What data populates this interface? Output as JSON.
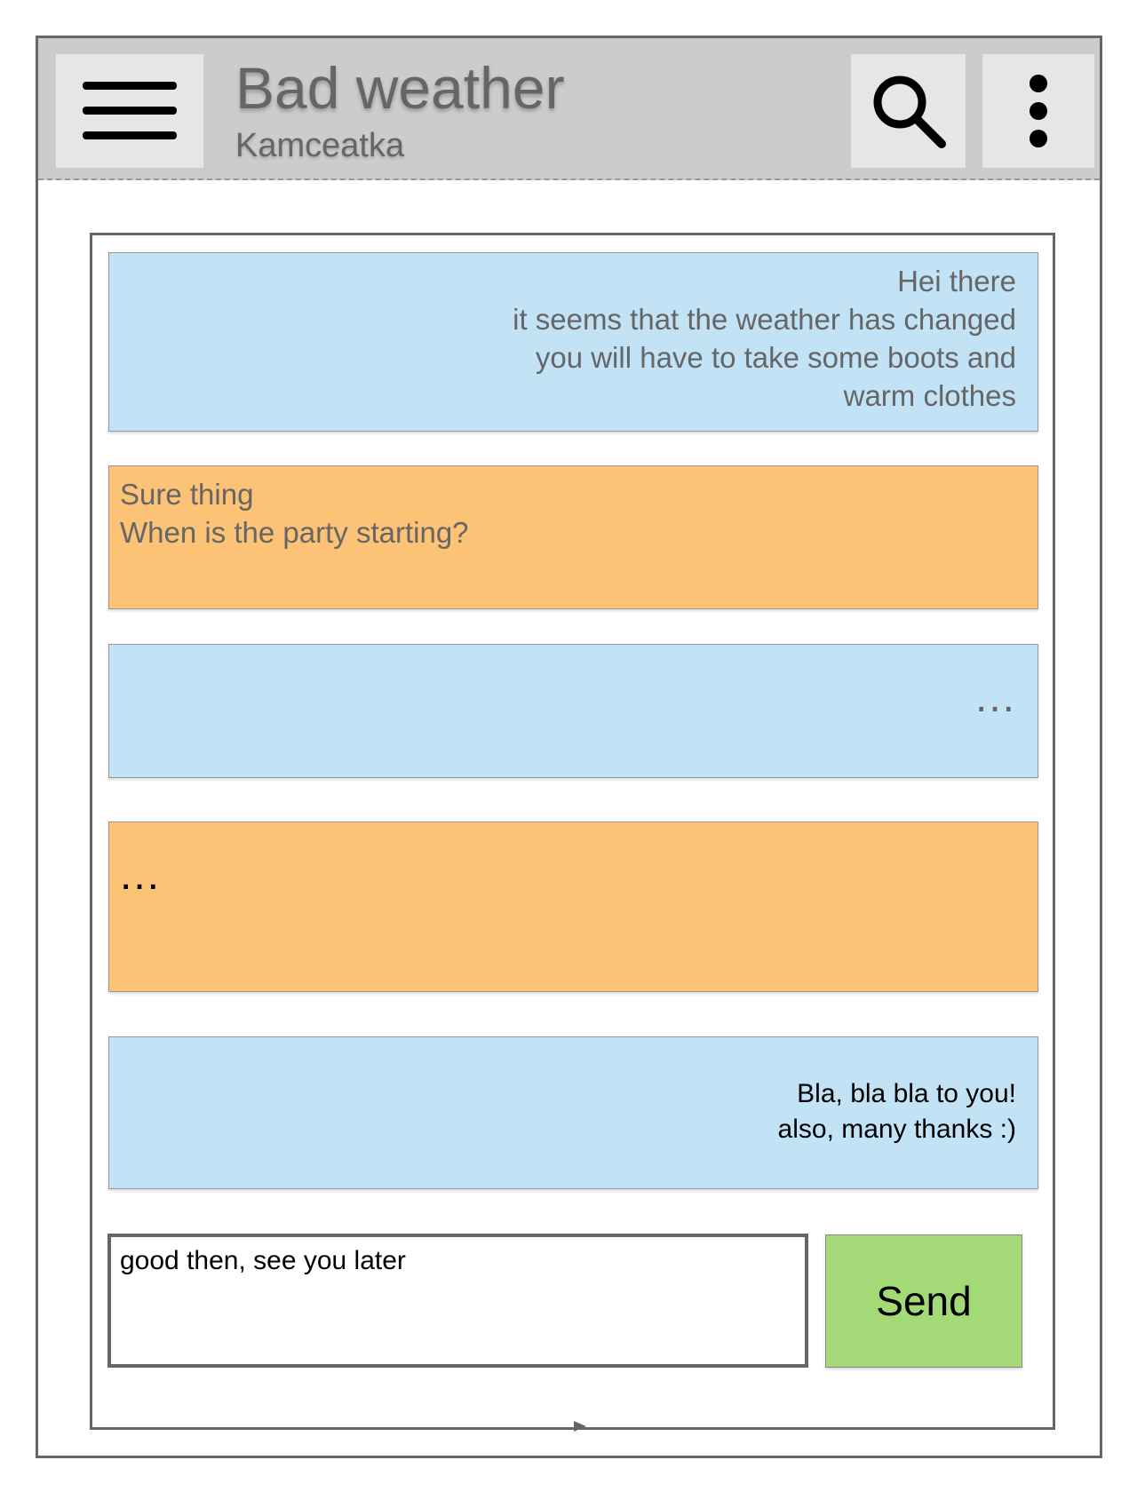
{
  "appbar": {
    "title": "Bad weather",
    "subtitle": "Kamceatka",
    "menu_icon": "hamburger-menu-icon",
    "search_icon": "search-icon",
    "more_icon": "more-vertical-icon"
  },
  "messages": [
    {
      "side": "incoming",
      "color": "#c2e3f5",
      "lines": [
        "Hei there",
        "it seems that the weather has changed",
        "you will have to take some boots and",
        "warm clothes"
      ]
    },
    {
      "side": "outgoing",
      "color": "#fcc275",
      "lines": [
        "Sure thing",
        "When is the party starting?"
      ]
    },
    {
      "side": "incoming",
      "color": "#c2e3f5",
      "lines": [
        "..."
      ]
    },
    {
      "side": "outgoing",
      "color": "#fcc275",
      "lines": [
        "..."
      ]
    },
    {
      "side": "incoming",
      "color": "#c2e3f5",
      "lines": [
        "Bla, bla bla to you!",
        "also, many thanks :)"
      ]
    }
  ],
  "composer": {
    "value": "good then, see you later",
    "send_label": "Send",
    "send_color": "#a3d977"
  }
}
